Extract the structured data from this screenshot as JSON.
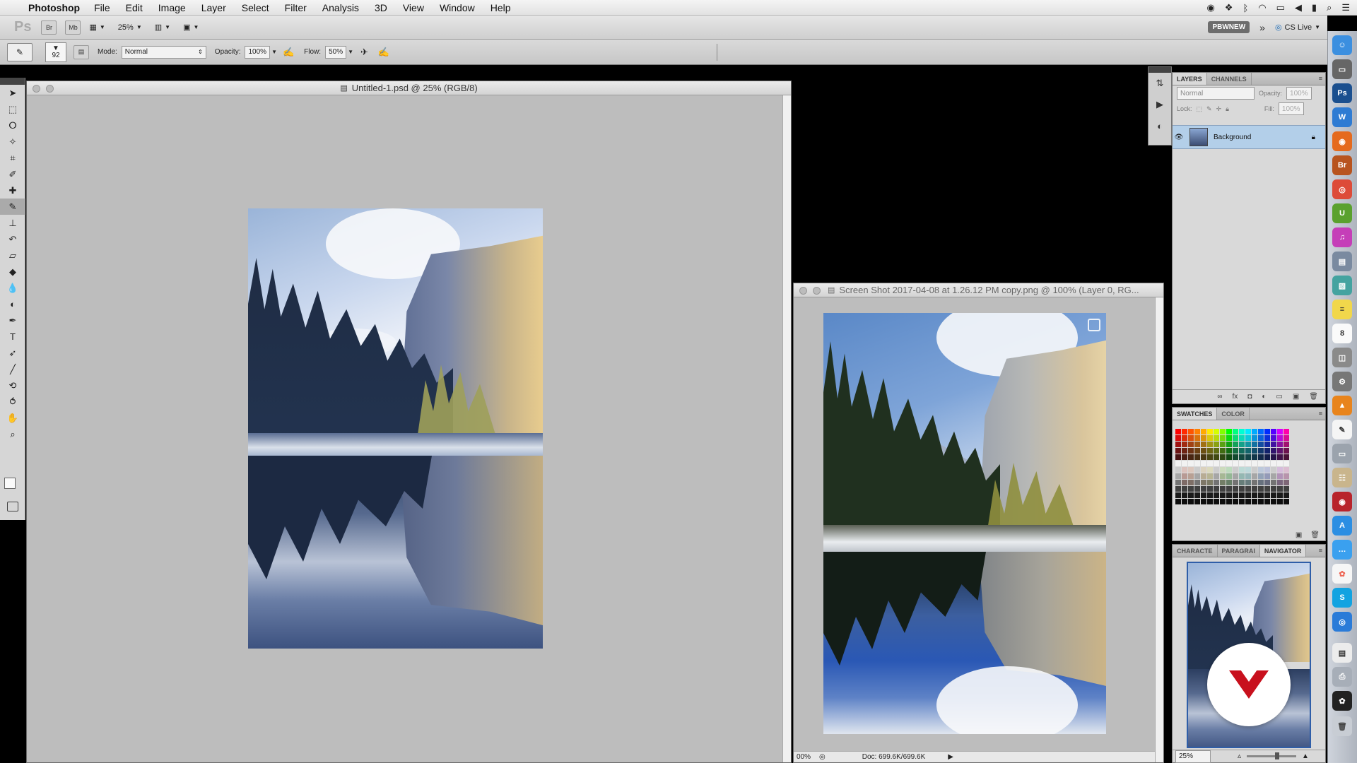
{
  "menubar": {
    "app_name": "Photoshop",
    "items": [
      "File",
      "Edit",
      "Image",
      "Layer",
      "Select",
      "Filter",
      "Analysis",
      "3D",
      "View",
      "Window",
      "Help"
    ]
  },
  "appbar": {
    "ps_logo": "Ps",
    "bridge_btn": "Br",
    "minibridge_btn": "Mb",
    "zoom_value": "25%",
    "workspace_btn": "PBWNEW",
    "more_btn": "»",
    "cs_live": "CS Live"
  },
  "options": {
    "brush_size": "92",
    "mode_label": "Mode:",
    "mode_value": "Normal",
    "opacity_label": "Opacity:",
    "opacity_value": "100%",
    "flow_label": "Flow:",
    "flow_value": "50%"
  },
  "doc1": {
    "title": "Untitled-1.psd @ 25% (RGB/8)"
  },
  "doc2": {
    "title": "Screen Shot 2017-04-08 at 1.26.12 PM copy.png @ 100% (Layer 0, RG...",
    "zoom": "00%",
    "doc_size": "Doc: 699.6K/699.6K"
  },
  "layers_panel": {
    "tabs": [
      "LAYERS",
      "CHANNELS"
    ],
    "blend_mode": "Normal",
    "opacity_label": "Opacity:",
    "opacity_value": "100%",
    "lock_label": "Lock:",
    "fill_label": "Fill:",
    "fill_value": "100%",
    "layer_name": "Background"
  },
  "swatches_panel": {
    "tabs": [
      "SWATCHES",
      "COLOR"
    ]
  },
  "navigator_panel": {
    "tabs": [
      "CHARACTE",
      "PARAGRAI",
      "NAVIGATOR"
    ],
    "zoom": "25%"
  },
  "colors": {
    "layer_selected": "#b3cfe9",
    "logo_red": "#c8101d"
  }
}
